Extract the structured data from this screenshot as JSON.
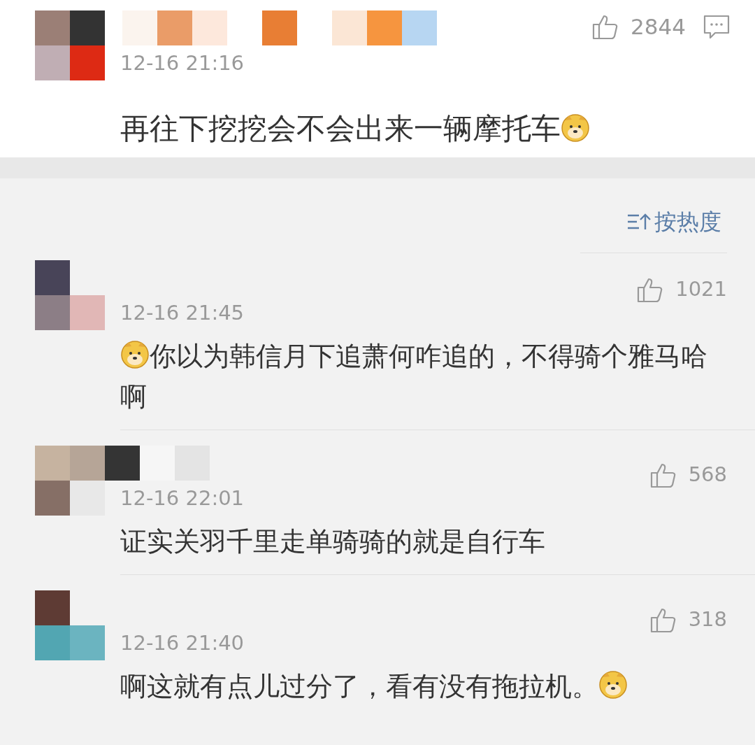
{
  "main_comment": {
    "time": "12-16 21:16",
    "likes": "2844",
    "parts": [
      {
        "kind": "text",
        "text": "再往下挖挖会不会出来一辆摩托车"
      },
      {
        "kind": "emoji"
      }
    ]
  },
  "sort": {
    "label": "按热度"
  },
  "replies": [
    {
      "time": "12-16 21:45",
      "likes": "1021",
      "parts": [
        {
          "kind": "emoji"
        },
        {
          "kind": "text",
          "text": "你以为韩信月下追萧何咋追的，不得骑个雅马哈啊"
        }
      ]
    },
    {
      "time": "12-16 22:01",
      "likes": "568",
      "parts": [
        {
          "kind": "text",
          "text": "证实关羽千里走单骑骑的就是自行车"
        }
      ]
    },
    {
      "time": "12-16 21:40",
      "likes": "318",
      "parts": [
        {
          "kind": "text",
          "text": "啊这就有点儿过分了，看有没有拖拉机。"
        },
        {
          "kind": "emoji"
        }
      ]
    }
  ]
}
